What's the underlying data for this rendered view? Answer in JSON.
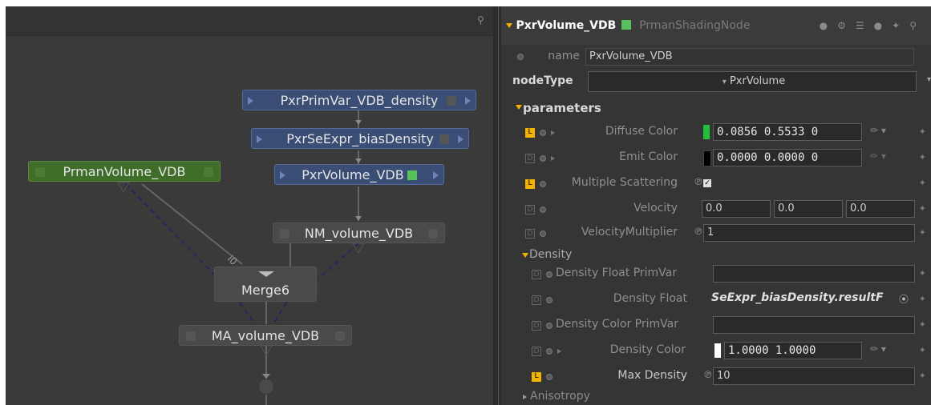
{
  "graph": {
    "nodes": {
      "primvar_density": "PxrPrimVar_VDB_density",
      "seexpr_bias": "PxrSeExpr_biasDensity",
      "pxrvolume": "PxrVolume_VDB",
      "prman_volume": "PrmanVolume_VDB",
      "nm_volume": "NM_volume_VDB",
      "merge": "Merge6",
      "ma_volume": "MA_volume_VDB"
    },
    "wire_label": "i0"
  },
  "panel": {
    "header": {
      "node_name": "PxrVolume_VDB",
      "node_type": "PrmanShadingNode"
    },
    "name_label": "name",
    "name_value": "PxrVolume_VDB",
    "nodetype_label": "nodeType",
    "nodetype_value": "PxrVolume",
    "parameters_label": "parameters",
    "params": {
      "diffuse_color": {
        "label": "Diffuse Color",
        "v1": "0.0856",
        "v2": "0.5533",
        "v3": "0"
      },
      "emit_color": {
        "label": "Emit Color",
        "v1": "0.0000",
        "v2": "0.0000",
        "v3": "0"
      },
      "multiple_scattering": {
        "label": "Multiple Scattering"
      },
      "velocity": {
        "label": "Velocity",
        "v1": "0.0",
        "v2": "0.0",
        "v3": "0.0"
      },
      "velocity_multiplier": {
        "label": "VelocityMultiplier",
        "value": "1"
      }
    },
    "density_label": "Density",
    "density": {
      "float_primvar": {
        "label": "Density Float PrimVar"
      },
      "float": {
        "label": "Density Float",
        "value": "SeExpr_biasDensity.resultF"
      },
      "color_primvar": {
        "label": "Density Color PrimVar"
      },
      "color": {
        "label": "Density Color",
        "v1": "1.0000",
        "v2": "1.0000"
      },
      "max_density": {
        "label": "Max Density",
        "value": "10"
      }
    },
    "anisotropy_label": "Anisotropy"
  },
  "colors": {
    "accent": "#f0b400",
    "node_blue": "#3a4d74",
    "node_green": "#3f6e2a",
    "diffuse_swatch": "#21c23a",
    "emit_swatch": "#000000",
    "density_swatch": "#ffffff"
  }
}
